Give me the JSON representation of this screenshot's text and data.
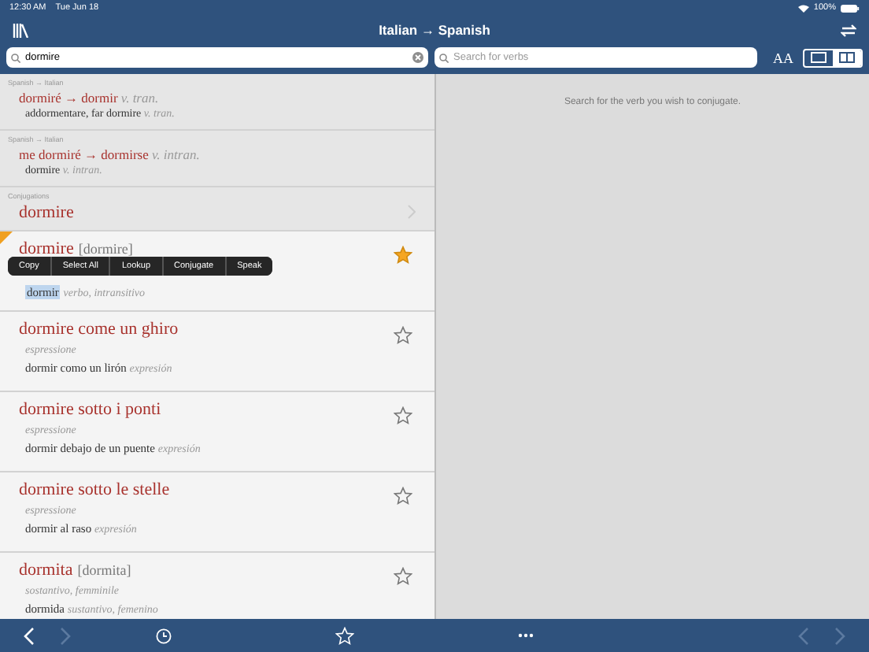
{
  "status_bar": {
    "time": "12:30 AM",
    "date": "Tue Jun 18",
    "battery": "100%"
  },
  "nav": {
    "title": "Italian → Spanish"
  },
  "search": {
    "value": "dormire"
  },
  "verb_search": {
    "placeholder": "Search for verbs"
  },
  "font_size_label": "AA",
  "layout_modes": [
    {
      "selected": false
    },
    {
      "selected": true
    }
  ],
  "results": [
    {
      "kind": "translation",
      "source": "Spanish → Italian",
      "headword": "dormiré → dormir",
      "pos": "v. tran.",
      "gloss": "addormentare, far dormire",
      "gloss_pos": "v. tran."
    },
    {
      "kind": "translation",
      "source": "Spanish → Italian",
      "headword": "me dormiré → dormirse",
      "pos": "v. intran.",
      "gloss": "dormire",
      "gloss_pos": "v. intran."
    },
    {
      "kind": "conjugation",
      "source": "Conjugations",
      "headword": "dormire"
    },
    {
      "kind": "entry",
      "headword": "dormire",
      "pron": "[dormire]",
      "translation": "dormir",
      "translation_pos": "verbo, intransitivo",
      "starred": true,
      "bookmarked": true,
      "text_selected": true,
      "menu": [
        "Copy",
        "Select All",
        "Lookup",
        "Conjugate",
        "Speak"
      ]
    },
    {
      "kind": "entry",
      "headword": "dormire come un ghiro",
      "pos": "espressione",
      "translation": "dormir como un lirón",
      "translation_pos": "expresión",
      "starred": false,
      "bookmarked": false,
      "text_selected": false
    },
    {
      "kind": "entry",
      "headword": "dormire sotto i ponti",
      "pos": "espressione",
      "translation": "dormir debajo de un puente",
      "translation_pos": "expresión",
      "starred": false,
      "bookmarked": false,
      "text_selected": false
    },
    {
      "kind": "entry",
      "headword": "dormire sotto le stelle",
      "pos": "espressione",
      "translation": "dormir al raso",
      "translation_pos": "expresión",
      "starred": false,
      "bookmarked": false,
      "text_selected": false
    },
    {
      "kind": "entry",
      "headword": "dormita",
      "pron": "[dormita]",
      "pos": "sostantivo, femminile",
      "translation": "dormida",
      "translation_pos": "sustantivo, femenino",
      "starred": false,
      "bookmarked": false,
      "text_selected": false
    }
  ],
  "conjugation_hint": "Search for the verb you wish to conjugate.",
  "toolbar": {
    "back_disabled": false,
    "forward_disabled": true,
    "right_back_disabled": true,
    "right_forward_disabled": true
  }
}
